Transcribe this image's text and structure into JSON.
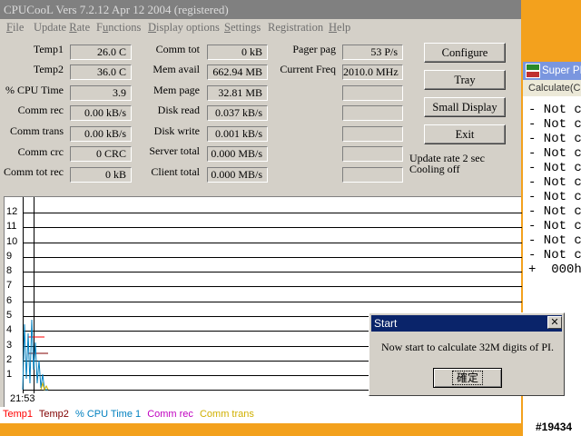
{
  "cpucool": {
    "title": "CPUCooL  Vers 7.2.12  Apr 12 2004 (registered)",
    "menu": [
      {
        "pre": "",
        "ul": "F",
        "post": "ile"
      },
      {
        "pre": "Update ",
        "ul": "R",
        "post": "ate"
      },
      {
        "pre": "F",
        "ul": "u",
        "post": "nctions"
      },
      {
        "pre": "",
        "ul": "D",
        "post": "isplay options"
      },
      {
        "pre": "",
        "ul": "S",
        "post": "ettings"
      },
      {
        "pre": "Re",
        "ul": "g",
        "post": "istration"
      },
      {
        "pre": "",
        "ul": "H",
        "post": "elp"
      }
    ],
    "col1": [
      {
        "label": "Temp1",
        "value": "26.0 C"
      },
      {
        "label": "Temp2",
        "value": "36.0 C"
      },
      {
        "label": "% CPU Time",
        "value": "3.9"
      },
      {
        "label": "Comm rec",
        "value": "0.00 kB/s"
      },
      {
        "label": "Comm trans",
        "value": "0.00 kB/s"
      },
      {
        "label": "Comm crc",
        "value": "0 CRC"
      },
      {
        "label": "Comm tot rec",
        "value": "0 kB"
      }
    ],
    "col2": [
      {
        "label": "Comm tot",
        "value": "0 kB"
      },
      {
        "label": "Mem avail",
        "value": "662.94 MB"
      },
      {
        "label": "Mem page",
        "value": "32.81 MB"
      },
      {
        "label": "Disk read",
        "value": "0.037 kB/s"
      },
      {
        "label": "Disk write",
        "value": "0.001 kB/s"
      },
      {
        "label": "Server total",
        "value": "0.000 MB/s"
      },
      {
        "label": "Client total",
        "value": "0.000 MB/s"
      }
    ],
    "col3": [
      {
        "label": "Pager pag",
        "value": "53 P/s"
      },
      {
        "label": "Current Freq",
        "value": "2010.0 MHz"
      },
      {
        "label": "",
        "value": ""
      },
      {
        "label": "",
        "value": ""
      },
      {
        "label": "",
        "value": ""
      },
      {
        "label": "",
        "value": ""
      },
      {
        "label": "",
        "value": ""
      }
    ],
    "buttons": {
      "configure": "Configure",
      "tray": "Tray",
      "small_display": "Small Display",
      "exit": "Exit"
    },
    "status": {
      "update_rate": "Update rate 2 sec",
      "cooling": "Cooling off"
    },
    "graph": {
      "y_labels": [
        "12",
        "11",
        "10",
        "9",
        "8",
        "7",
        "6",
        "5",
        "4",
        "3",
        "2",
        "1"
      ],
      "time_label": "21:53"
    },
    "legend": [
      {
        "text": "Temp1",
        "color": "#ff0000"
      },
      {
        "text": "Temp2",
        "color": "#800000"
      },
      {
        "text": "% CPU Time 1",
        "color": "#0080c0"
      },
      {
        "text": "Comm rec",
        "color": "#c000c0"
      },
      {
        "text": "Comm trans",
        "color": "#d0b000"
      }
    ]
  },
  "superpi": {
    "title": "Super PI",
    "menu_text": "Calculate(C",
    "lines": [
      "- Not c",
      "- Not c",
      "- Not c",
      "- Not c",
      "- Not c",
      "- Not c",
      "- Not c",
      "- Not c",
      "- Not c",
      "- Not c",
      "- Not c",
      "+  000h"
    ]
  },
  "dialog": {
    "title": "Start",
    "close_glyph": "✕",
    "message": "Now start to calculate   32M digits of PI.",
    "ok_label": "確定"
  },
  "watermark": "#19434",
  "colors": {
    "desktop": "#f3a11d",
    "dialog_title": "#0a246a",
    "superpi_title": "#7a96df"
  }
}
